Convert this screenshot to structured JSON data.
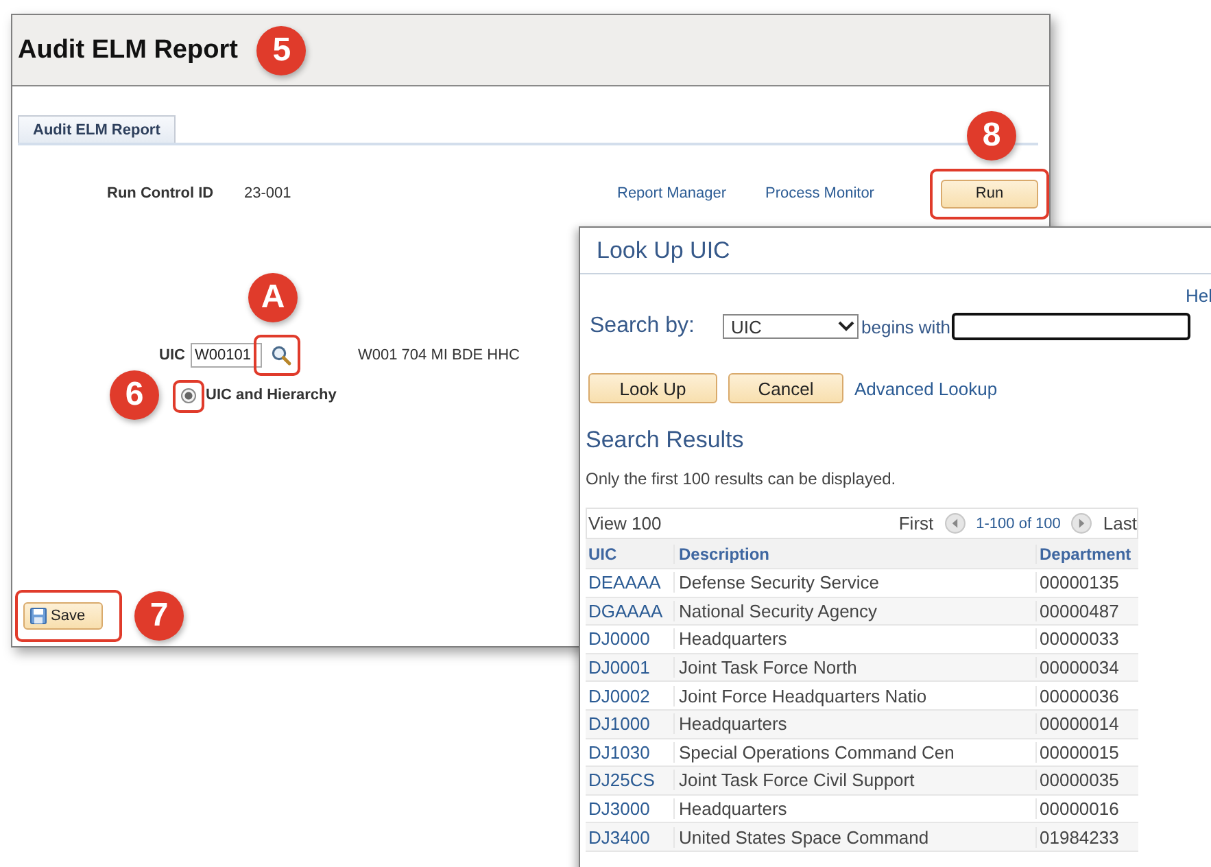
{
  "window": {
    "title": "Audit ELM Report",
    "callout": "5"
  },
  "tabs": [
    {
      "label": "Audit ELM Report",
      "selected": true
    }
  ],
  "run_control": {
    "label": "Run Control ID",
    "value": "23-001"
  },
  "links": [
    "Report Manager",
    "Process Monitor"
  ],
  "run_button": {
    "label": "Run",
    "callout": "8"
  },
  "uic": {
    "label": "UIC",
    "value": "W00101",
    "lookup_callout": "A",
    "description": "W001 704 MI BDE HHC"
  },
  "hierarchy_option": {
    "label": "UIC and Hierarchy",
    "selected": true,
    "callout": "6"
  },
  "save_button": {
    "label": "Save",
    "callout": "7"
  },
  "lookup": {
    "title": "Look Up UIC",
    "help": "Hel",
    "search_by_label": "Search by:",
    "search_field": "UIC",
    "operator": "begins with",
    "buttons": [
      "Look Up",
      "Cancel"
    ],
    "advanced_link": "Advanced Lookup",
    "results_title": "Search Results",
    "note": "Only the first 100 results can be displayed.",
    "view": "View 100",
    "first": "First",
    "range": "1-100 of 100",
    "last": "Last",
    "columns": [
      "UIC",
      "Description",
      "Department"
    ],
    "rows": [
      [
        "DEAAAA",
        "Defense Security Service",
        "00000135"
      ],
      [
        "DGAAAA",
        "National Security Agency",
        "00000487"
      ],
      [
        "DJ0000",
        "Headquarters",
        "00000033"
      ],
      [
        "DJ0001",
        "Joint Task Force North",
        "00000034"
      ],
      [
        "DJ0002",
        "Joint Force Headquarters Natio",
        "00000036"
      ],
      [
        "DJ1000",
        "Headquarters",
        "00000014"
      ],
      [
        "DJ1030",
        "Special Operations Command Cen",
        "00000015"
      ],
      [
        "DJ25CS",
        "Joint Task Force Civil Support",
        "00000035"
      ],
      [
        "DJ3000",
        "Headquarters",
        "00000016"
      ],
      [
        "DJ3400",
        "United States Space Command",
        "01984233"
      ]
    ]
  }
}
